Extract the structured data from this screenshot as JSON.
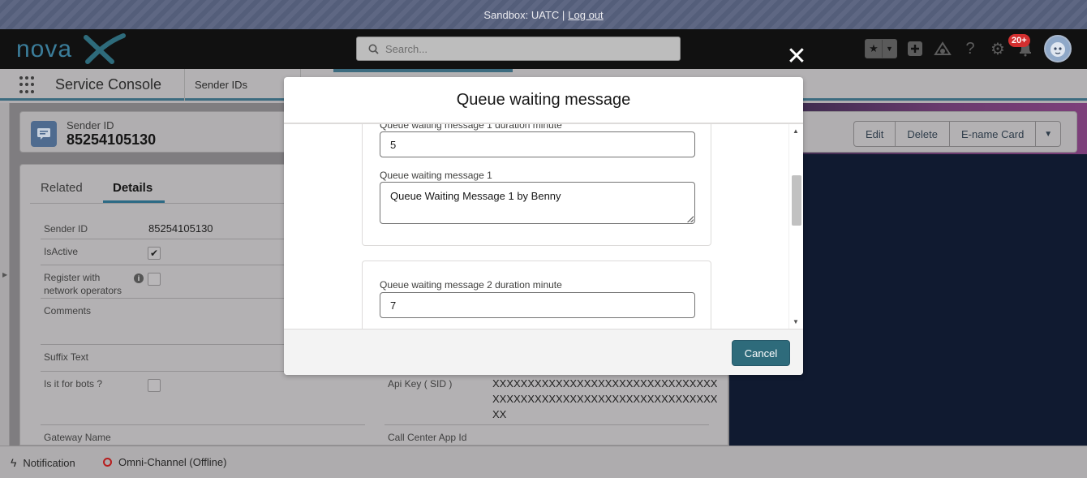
{
  "sandbox": {
    "text": "Sandbox: UATC |",
    "logout": "Log out"
  },
  "header": {
    "logo_text": "novaX",
    "search_placeholder": "Search...",
    "notification_count": "20+"
  },
  "nav": {
    "app_name": "Service Console",
    "tab_label": "Sender IDs"
  },
  "record": {
    "type_label": "Sender ID",
    "title": "85254105130",
    "actions": [
      "Edit",
      "Delete",
      "E-name Card"
    ]
  },
  "detail": {
    "tabs": [
      "Related",
      "Details"
    ],
    "fields": {
      "sender_id_label": "Sender ID",
      "sender_id_value": "85254105130",
      "is_active_label": "IsActive",
      "register_label_1": "Register with",
      "register_label_2": "network operators",
      "comments_label": "Comments",
      "suffix_label": "Suffix Text",
      "bots_label": "Is it for bots ?",
      "api_key_label": "Api Key ( SID )",
      "api_key_line1": "XXXXXXXXXXXXXXXXXXXXXXXXXXXXXXXX",
      "api_key_line2": "XXXXXXXXXXXXXXXXXXXXXXXXXXXXXXXX",
      "api_key_line3": "XX",
      "gateway_label": "Gateway Name",
      "call_center_label": "Call Center App Id"
    }
  },
  "modal": {
    "title": "Queue waiting message",
    "fields": {
      "msg1_duration_label": "Queue waiting message 1 duration minute",
      "msg1_duration_value": "5",
      "msg1_label": "Queue waiting message 1",
      "msg1_value": "Queue Waiting Message 1 by Benny",
      "msg2_duration_label": "Queue waiting message 2 duration minute",
      "msg2_duration_value": "7"
    },
    "cancel_label": "Cancel"
  },
  "utility": {
    "notification_label": "Notification",
    "omni_label": "Omni-Channel (Offline)"
  },
  "colors": {
    "brand_teal": "#2e6b7b",
    "badge_red": "#d32f2f",
    "header_bg": "#111111",
    "sandbox_bg": "#57617e"
  }
}
